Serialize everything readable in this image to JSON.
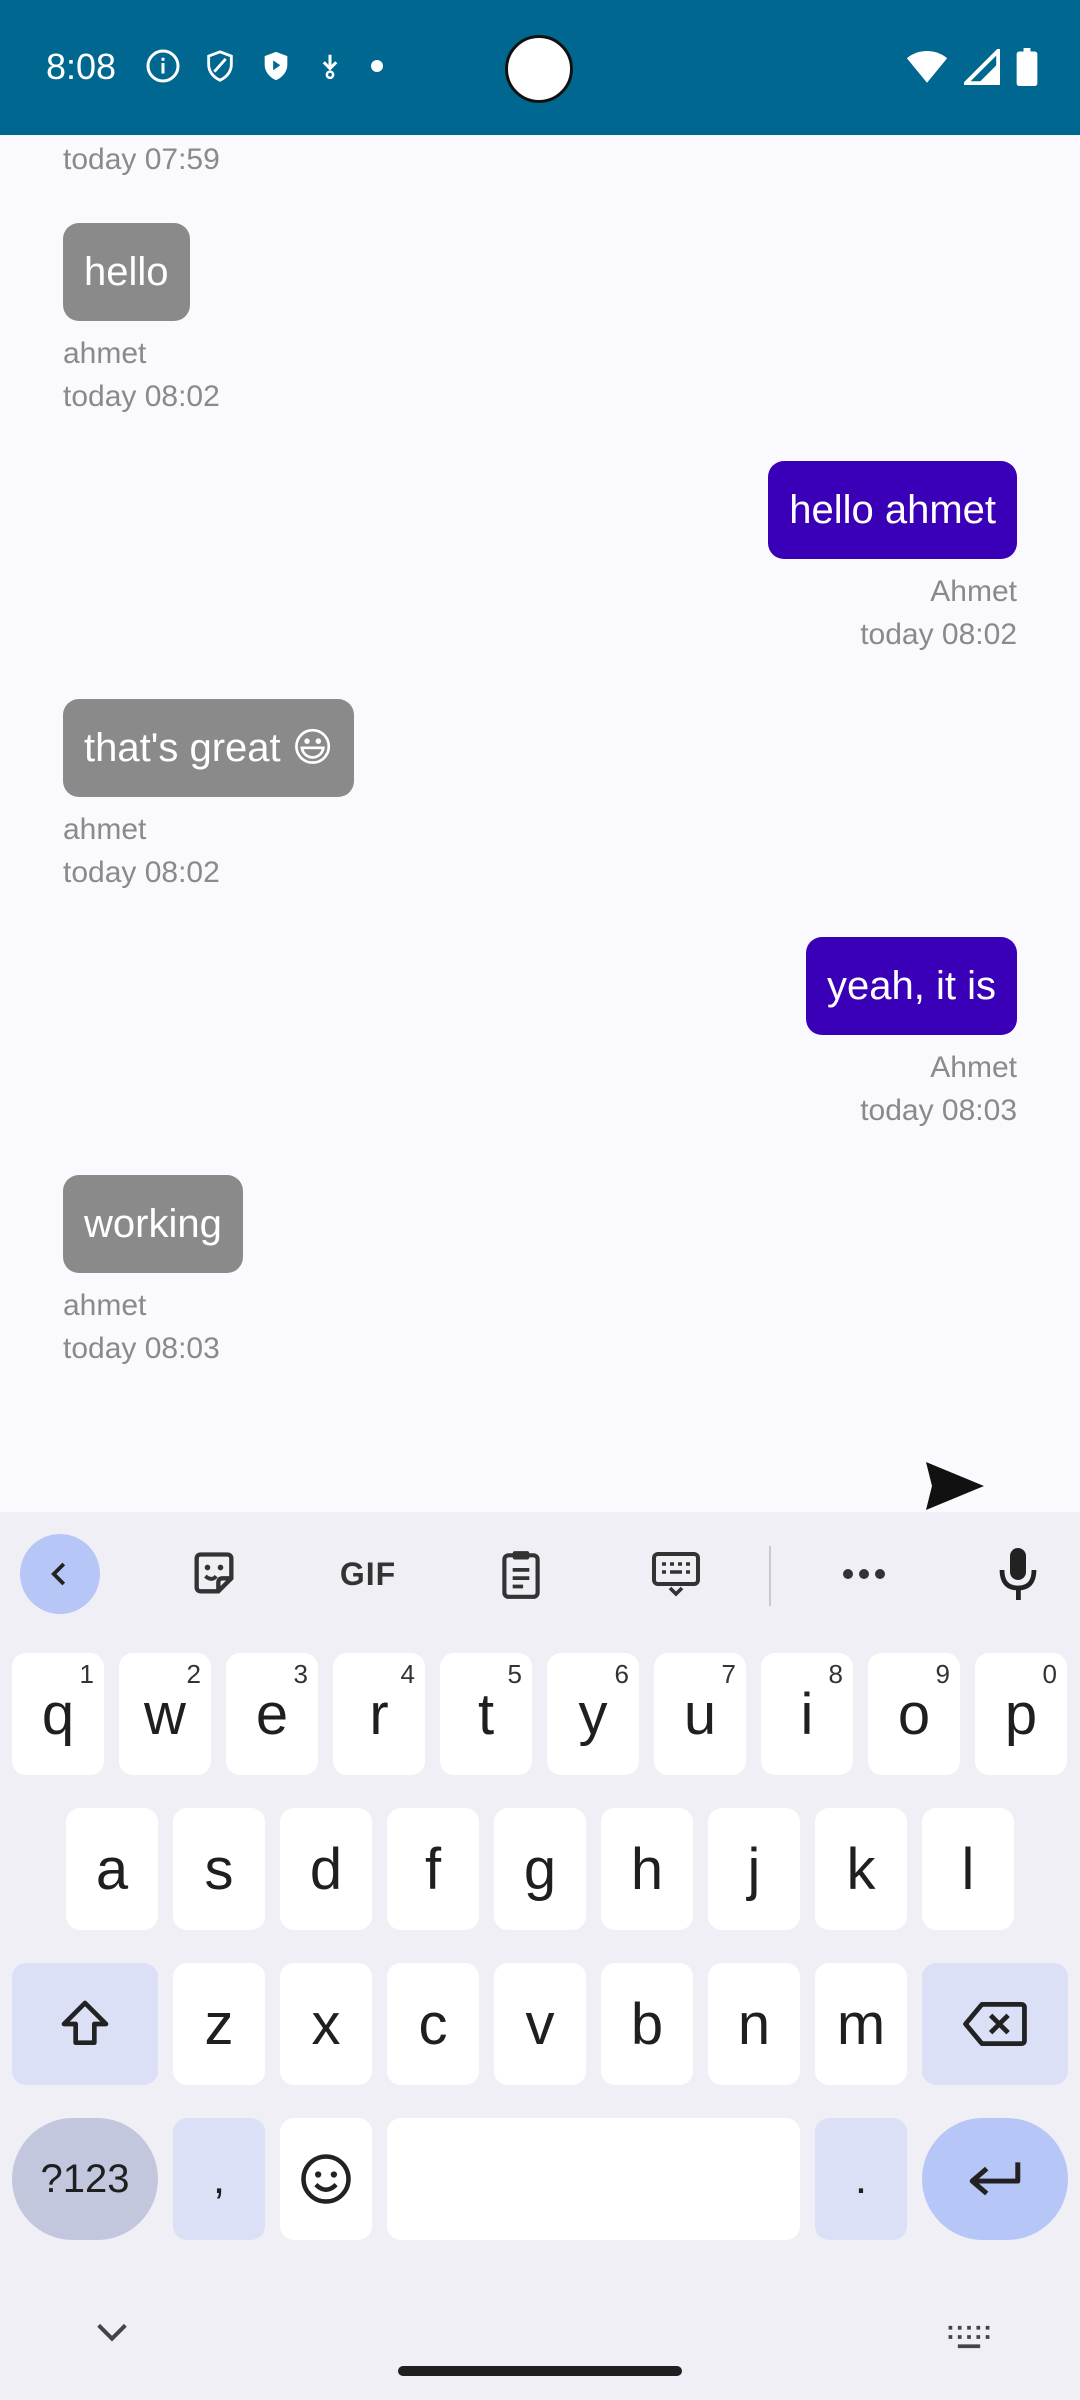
{
  "status_bar": {
    "time": "8:08",
    "left_icons": [
      "info-icon",
      "shield-icon",
      "shield-play-icon",
      "download-icon",
      "dot-icon"
    ],
    "right_icons": [
      "wifi-icon",
      "signal-icon",
      "battery-icon"
    ],
    "bg_color": "#006890"
  },
  "chat": {
    "top_partial_time": "today 07:59",
    "messages": [
      {
        "direction": "incoming",
        "text": "hello",
        "sender": "ahmet",
        "time": "today 08:02"
      },
      {
        "direction": "outgoing",
        "text": "hello ahmet",
        "sender": "Ahmet",
        "time": "today 08:02"
      },
      {
        "direction": "incoming",
        "text": "that's great 😃",
        "sender": "ahmet",
        "time": "today 08:02"
      },
      {
        "direction": "outgoing",
        "text": "yeah, it is",
        "sender": "Ahmet",
        "time": "today 08:03"
      },
      {
        "direction": "incoming",
        "text": "working",
        "sender": "ahmet",
        "time": "today 08:03"
      }
    ],
    "incoming_color": "#8a8a8a",
    "outgoing_color": "#3a00b8",
    "send_icon": "send-icon"
  },
  "keyboard": {
    "toolbar": {
      "gif_label": "GIF",
      "icons": [
        "chevron-left-icon",
        "sticker-icon",
        "gif-icon",
        "clipboard-icon",
        "keyboard-layout-icon",
        "more-icon",
        "mic-icon"
      ]
    },
    "row1": [
      {
        "k": "q",
        "s": "1"
      },
      {
        "k": "w",
        "s": "2"
      },
      {
        "k": "e",
        "s": "3"
      },
      {
        "k": "r",
        "s": "4"
      },
      {
        "k": "t",
        "s": "5"
      },
      {
        "k": "y",
        "s": "6"
      },
      {
        "k": "u",
        "s": "7"
      },
      {
        "k": "i",
        "s": "8"
      },
      {
        "k": "o",
        "s": "9"
      },
      {
        "k": "p",
        "s": "0"
      }
    ],
    "row2": [
      "a",
      "s",
      "d",
      "f",
      "g",
      "h",
      "j",
      "k",
      "l"
    ],
    "row3": [
      "z",
      "x",
      "c",
      "v",
      "b",
      "n",
      "m"
    ],
    "symbols_label": "?123",
    "comma_label": ",",
    "period_label": ".",
    "accent_color": "#b6c7f7"
  }
}
